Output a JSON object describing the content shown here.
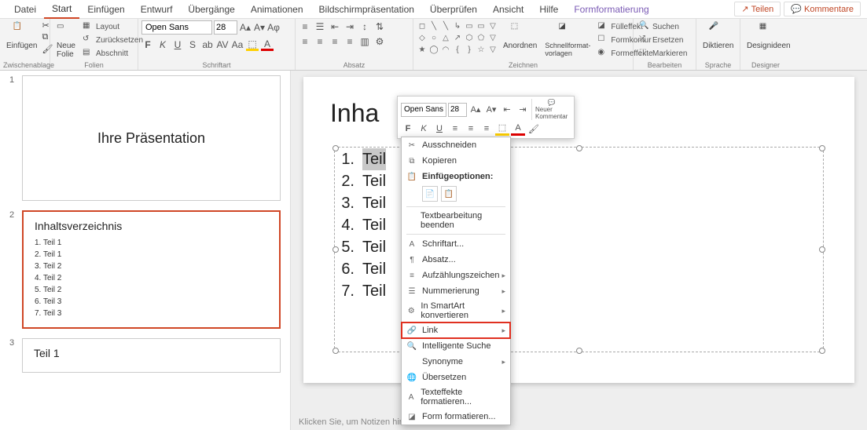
{
  "menu": {
    "tabs": [
      "Datei",
      "Start",
      "Einfügen",
      "Entwurf",
      "Übergänge",
      "Animationen",
      "Bildschirmpräsentation",
      "Überprüfen",
      "Ansicht",
      "Hilfe",
      "Formformatierung"
    ],
    "active": "Start",
    "share": "Teilen",
    "comments": "Kommentare"
  },
  "ribbon": {
    "clipboard": {
      "label": "Zwischenablage",
      "paste": "Einfügen"
    },
    "slides": {
      "label": "Folien",
      "new": "Neue\nFolie",
      "layout": "Layout",
      "reset": "Zurücksetzen",
      "section": "Abschnitt"
    },
    "font": {
      "label": "Schriftart",
      "name": "Open Sans",
      "size": "28"
    },
    "paragraph": {
      "label": "Absatz"
    },
    "drawing": {
      "label": "Zeichnen",
      "arrange": "Anordnen",
      "quickstyles": "Schnellformat-\nvorlagen",
      "fill": "Fülleffekt",
      "outline": "Formkontur",
      "effects": "Formeffekte"
    },
    "editing": {
      "label": "Bearbeiten",
      "find": "Suchen",
      "replace": "Ersetzen",
      "select": "Markieren"
    },
    "voice": {
      "label": "Sprache",
      "dictate": "Diktieren"
    },
    "designer": {
      "label": "Designer",
      "ideas": "Designideen"
    }
  },
  "thumbs": [
    {
      "num": "1",
      "type": "title",
      "title": "Ihre Präsentation"
    },
    {
      "num": "2",
      "type": "toc",
      "title": "Inhaltsverzeichnis",
      "items": [
        "1.  Teil 1",
        "2.  Teil 1",
        "3.  Teil 2",
        "4.  Teil 2",
        "5.  Teil 2",
        "6.  Teil 3",
        "7.  Teil 3"
      ]
    },
    {
      "num": "3",
      "type": "content",
      "title": "Teil 1"
    }
  ],
  "slide": {
    "title_prefix": "Inha",
    "toc": [
      {
        "n": "1.",
        "t": "Teil"
      },
      {
        "n": "2.",
        "t": "Teil"
      },
      {
        "n": "3.",
        "t": "Teil"
      },
      {
        "n": "4.",
        "t": "Teil"
      },
      {
        "n": "5.",
        "t": "Teil"
      },
      {
        "n": "6.",
        "t": "Teil"
      },
      {
        "n": "7.",
        "t": "Teil"
      }
    ],
    "notes": "Klicken Sie, um Notizen hin"
  },
  "mini": {
    "font": "Open Sans",
    "size": "28",
    "new_comment": "Neuer\nKommentar"
  },
  "ctx": {
    "cut": "Ausschneiden",
    "copy": "Kopieren",
    "paste_opts": "Einfügeoptionen:",
    "exit_edit": "Textbearbeitung beenden",
    "font": "Schriftart...",
    "para": "Absatz...",
    "bullets": "Aufzählungszeichen",
    "numbering": "Nummerierung",
    "smartart": "In SmartArt konvertieren",
    "link": "Link",
    "smart_search": "Intelligente Suche",
    "synonyms": "Synonyme",
    "translate": "Übersetzen",
    "text_effects": "Texteffekte formatieren...",
    "shape_format": "Form formatieren..."
  }
}
